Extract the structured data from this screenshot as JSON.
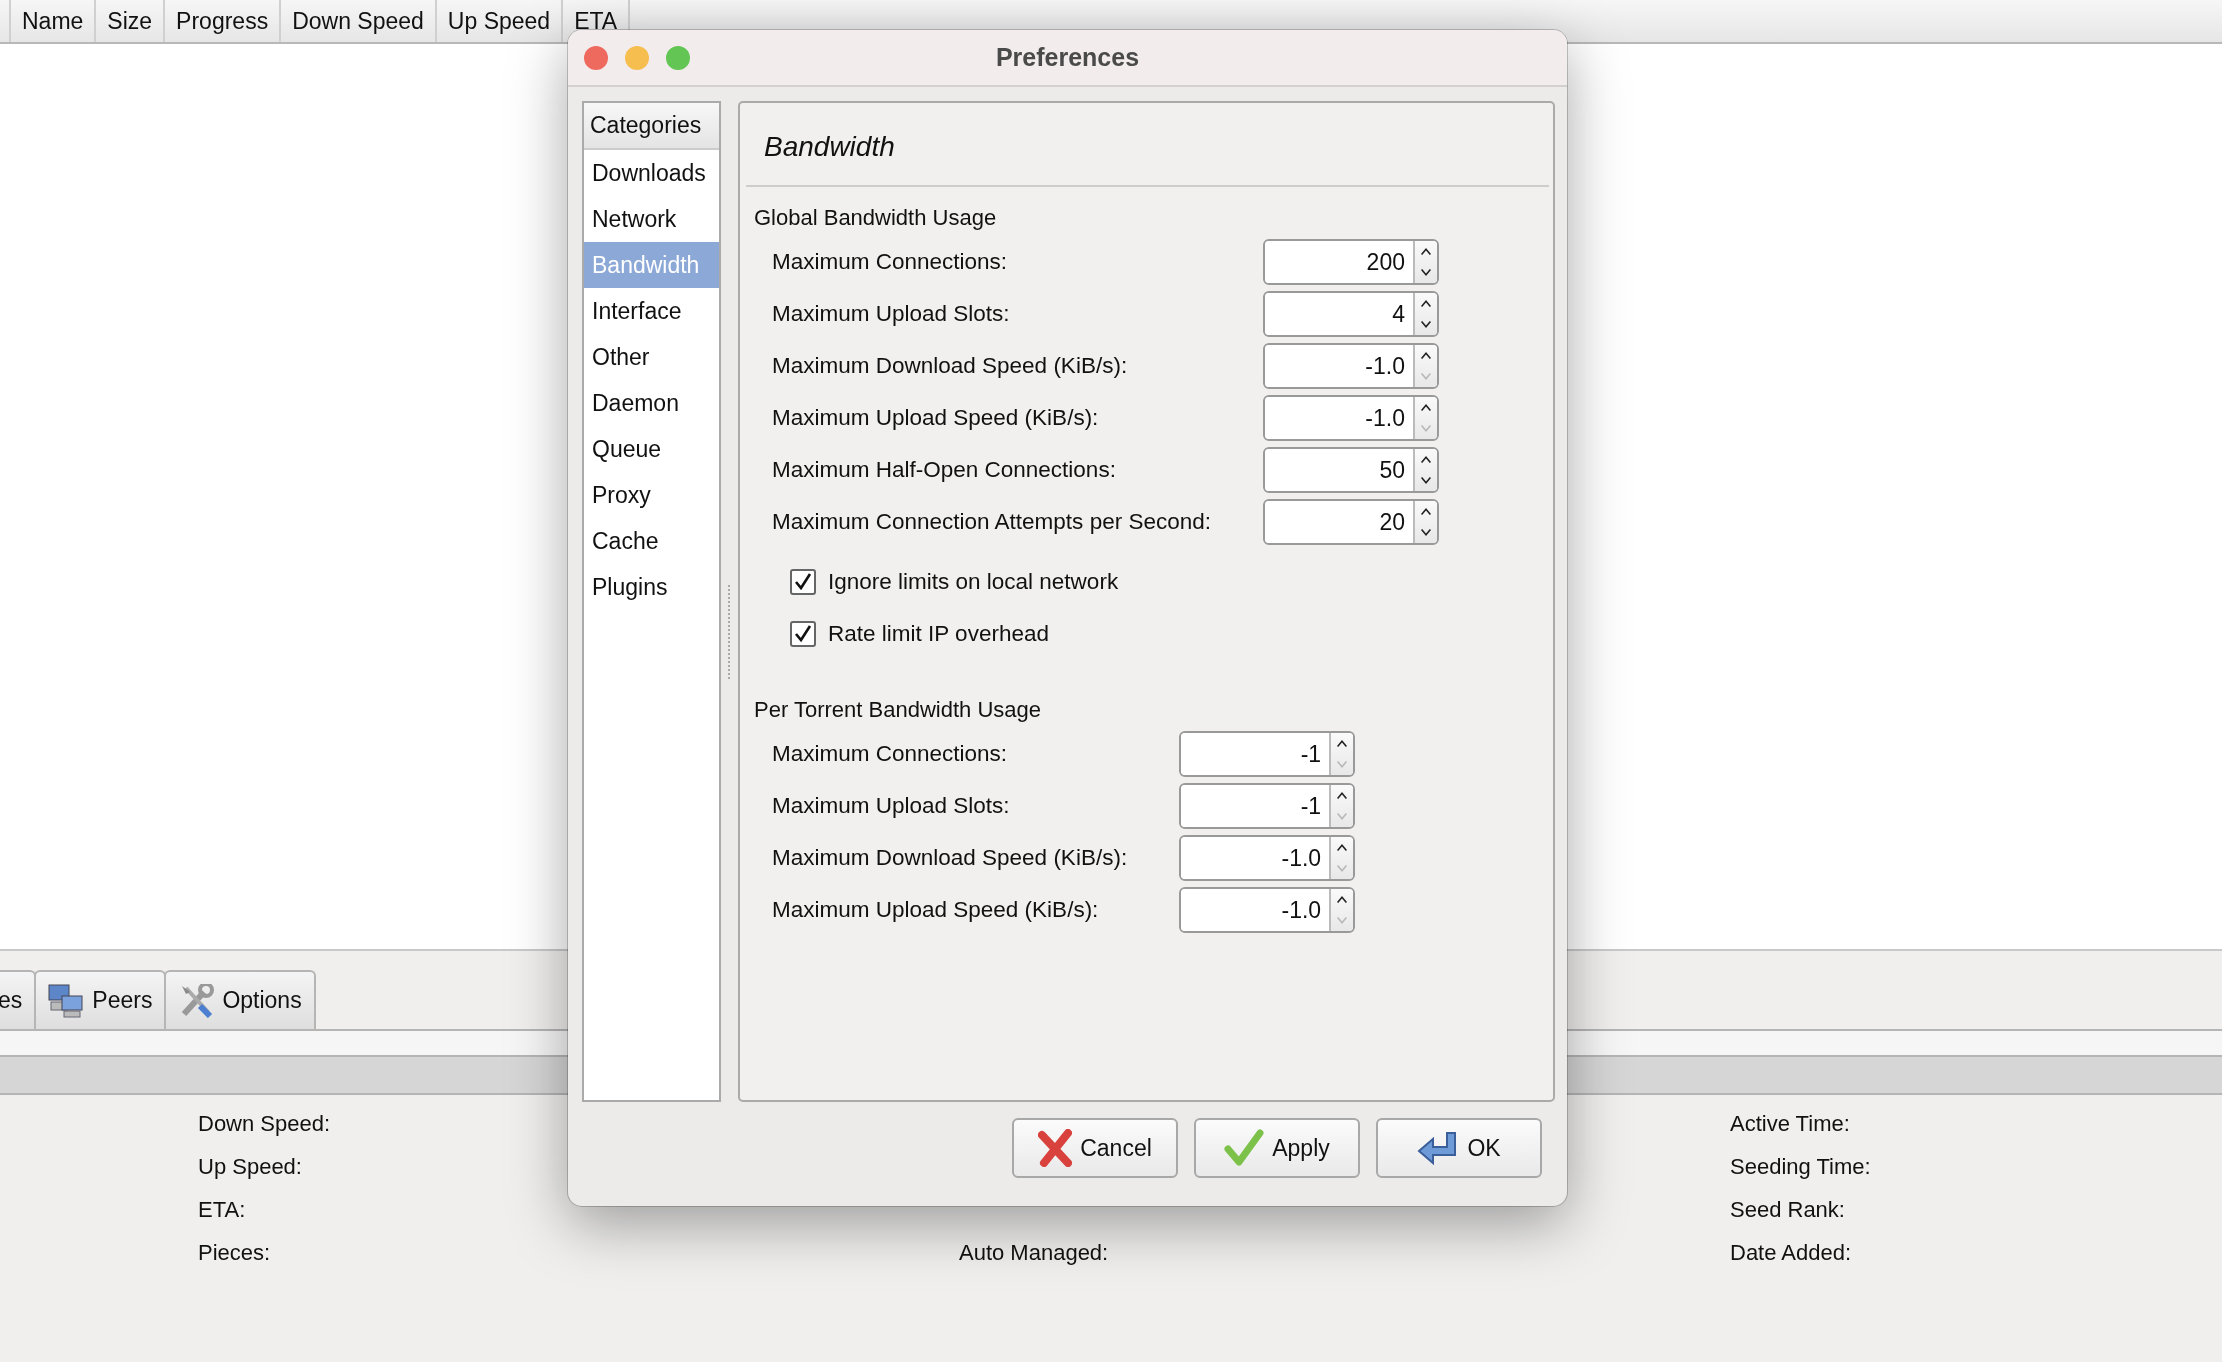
{
  "main_window": {
    "columns": [
      "Name",
      "Size",
      "Progress",
      "Down Speed",
      "Up Speed",
      "ETA"
    ],
    "tabs": [
      {
        "label": "es",
        "kind": "plain"
      },
      {
        "label": "Peers",
        "kind": "peers"
      },
      {
        "label": "Options",
        "kind": "options"
      }
    ],
    "details": [
      {
        "column_1": "Down Speed:",
        "column_3": "Active Time:"
      },
      {
        "column_1": "Up Speed:",
        "column_3": "Seeding Time:"
      },
      {
        "column_1": "ETA:",
        "column_3": "Seed Rank:"
      },
      {
        "column_1": "Pieces:",
        "column_2": "Auto Managed:",
        "column_3": "Date Added:"
      }
    ]
  },
  "dialog": {
    "title": "Preferences",
    "categories": {
      "header": "Categories",
      "items": [
        {
          "label": "Downloads",
          "selected": false
        },
        {
          "label": "Network",
          "selected": false
        },
        {
          "label": "Bandwidth",
          "selected": true
        },
        {
          "label": "Interface",
          "selected": false
        },
        {
          "label": "Other",
          "selected": false
        },
        {
          "label": "Daemon",
          "selected": false
        },
        {
          "label": "Queue",
          "selected": false
        },
        {
          "label": "Proxy",
          "selected": false
        },
        {
          "label": "Cache",
          "selected": false
        },
        {
          "label": "Plugins",
          "selected": false
        }
      ]
    },
    "page_title": "Bandwidth",
    "sections": [
      {
        "title": "Global Bandwidth Usage",
        "fields": [
          {
            "label": "Maximum Connections:",
            "value": "200",
            "down_disabled": false
          },
          {
            "label": "Maximum Upload Slots:",
            "value": "4",
            "down_disabled": false
          },
          {
            "label": "Maximum Download Speed (KiB/s):",
            "value": "-1.0",
            "down_disabled": true
          },
          {
            "label": "Maximum Upload Speed (KiB/s):",
            "value": "-1.0",
            "down_disabled": true
          },
          {
            "label": "Maximum Half-Open Connections:",
            "value": "50",
            "down_disabled": false
          },
          {
            "label": "Maximum Connection Attempts per Second:",
            "value": "20",
            "down_disabled": false
          }
        ],
        "checks": [
          {
            "label": "Ignore limits on local network",
            "checked": true
          },
          {
            "label": "Rate limit IP overhead",
            "checked": true
          }
        ]
      },
      {
        "title": "Per Torrent Bandwidth Usage",
        "fields": [
          {
            "label": "Maximum Connections:",
            "value": "-1",
            "down_disabled": true
          },
          {
            "label": "Maximum Upload Slots:",
            "value": "-1",
            "down_disabled": true
          },
          {
            "label": "Maximum Download Speed (KiB/s):",
            "value": "-1.0",
            "down_disabled": true
          },
          {
            "label": "Maximum Upload Speed (KiB/s):",
            "value": "-1.0",
            "down_disabled": true
          }
        ]
      }
    ],
    "buttons": [
      {
        "label": "Cancel",
        "kind": "cancel"
      },
      {
        "label": "Apply",
        "kind": "apply"
      },
      {
        "label": "OK",
        "kind": "ok"
      }
    ]
  }
}
